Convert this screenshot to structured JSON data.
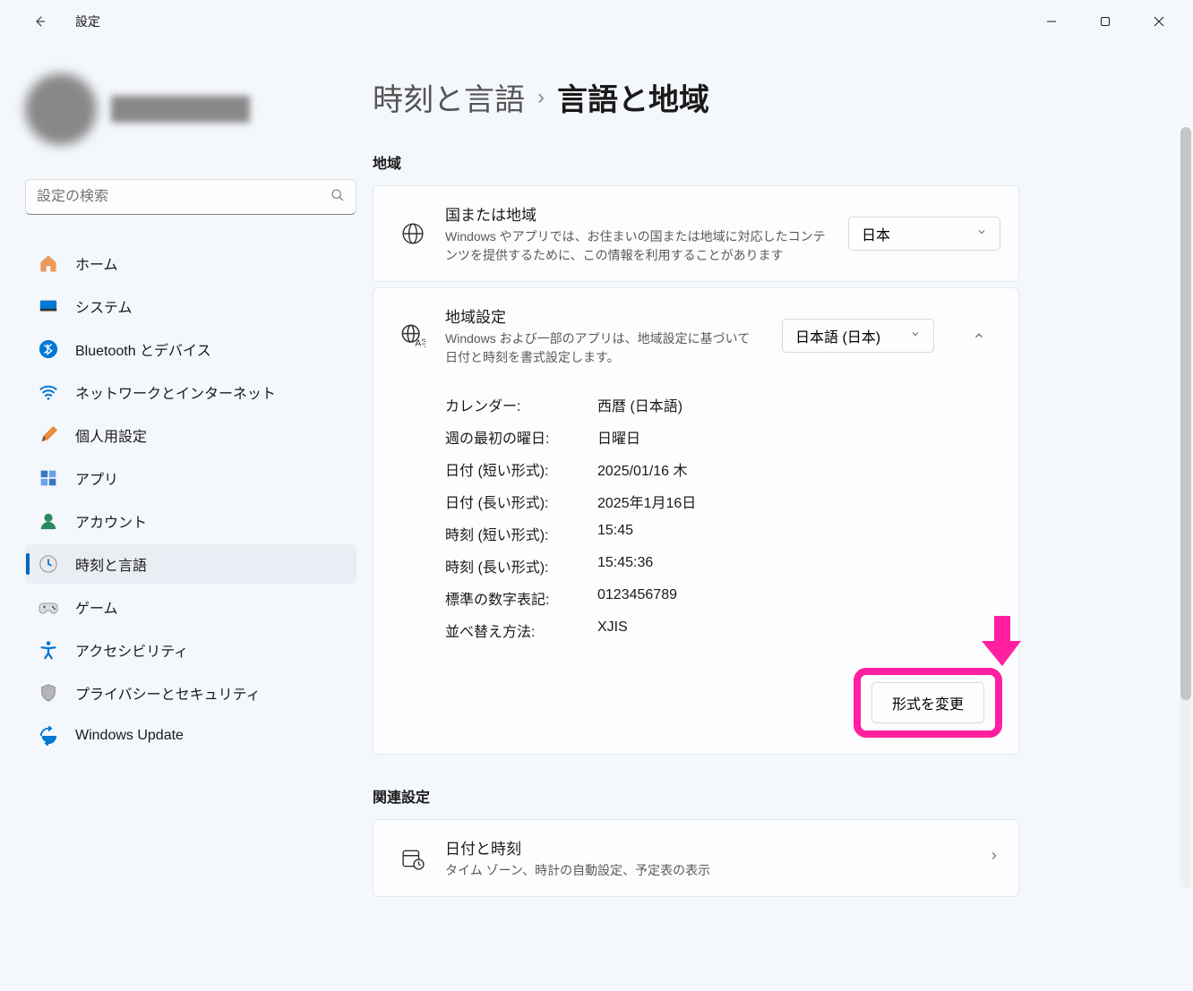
{
  "window": {
    "title": "設定"
  },
  "search": {
    "placeholder": "設定の検索"
  },
  "nav": {
    "items": [
      {
        "label": "ホーム"
      },
      {
        "label": "システム"
      },
      {
        "label": "Bluetooth とデバイス"
      },
      {
        "label": "ネットワークとインターネット"
      },
      {
        "label": "個人用設定"
      },
      {
        "label": "アプリ"
      },
      {
        "label": "アカウント"
      },
      {
        "label": "時刻と言語"
      },
      {
        "label": "ゲーム"
      },
      {
        "label": "アクセシビリティ"
      },
      {
        "label": "プライバシーとセキュリティ"
      },
      {
        "label": "Windows Update"
      }
    ]
  },
  "breadcrumb": {
    "parent": "時刻と言語",
    "current": "言語と地域"
  },
  "sections": {
    "region": "地域",
    "related": "関連設定"
  },
  "region_card": {
    "title": "国または地域",
    "desc": "Windows やアプリでは、お住まいの国または地域に対応したコンテンツを提供するために、この情報を利用することがあります",
    "value": "日本"
  },
  "format_card": {
    "title": "地域設定",
    "desc": "Windows および一部のアプリは、地域設定に基づいて日付と時刻を書式設定します。",
    "value": "日本語 (日本)",
    "details": {
      "rows": [
        {
          "label": "カレンダー:",
          "value": "西暦 (日本語)"
        },
        {
          "label": "週の最初の曜日:",
          "value": "日曜日"
        },
        {
          "label": "日付 (短い形式):",
          "value": "2025/01/16 木"
        },
        {
          "label": "日付 (長い形式):",
          "value": "2025年1月16日"
        },
        {
          "label": "時刻 (短い形式):",
          "value": "15:45"
        },
        {
          "label": "時刻 (長い形式):",
          "value": "15:45:36"
        },
        {
          "label": "標準の数字表記:",
          "value": "0123456789"
        },
        {
          "label": "並べ替え方法:",
          "value": "XJIS"
        }
      ]
    },
    "change_button": "形式を変更"
  },
  "datetime_card": {
    "title": "日付と時刻",
    "desc": "タイム ゾーン、時計の自動設定、予定表の表示"
  }
}
